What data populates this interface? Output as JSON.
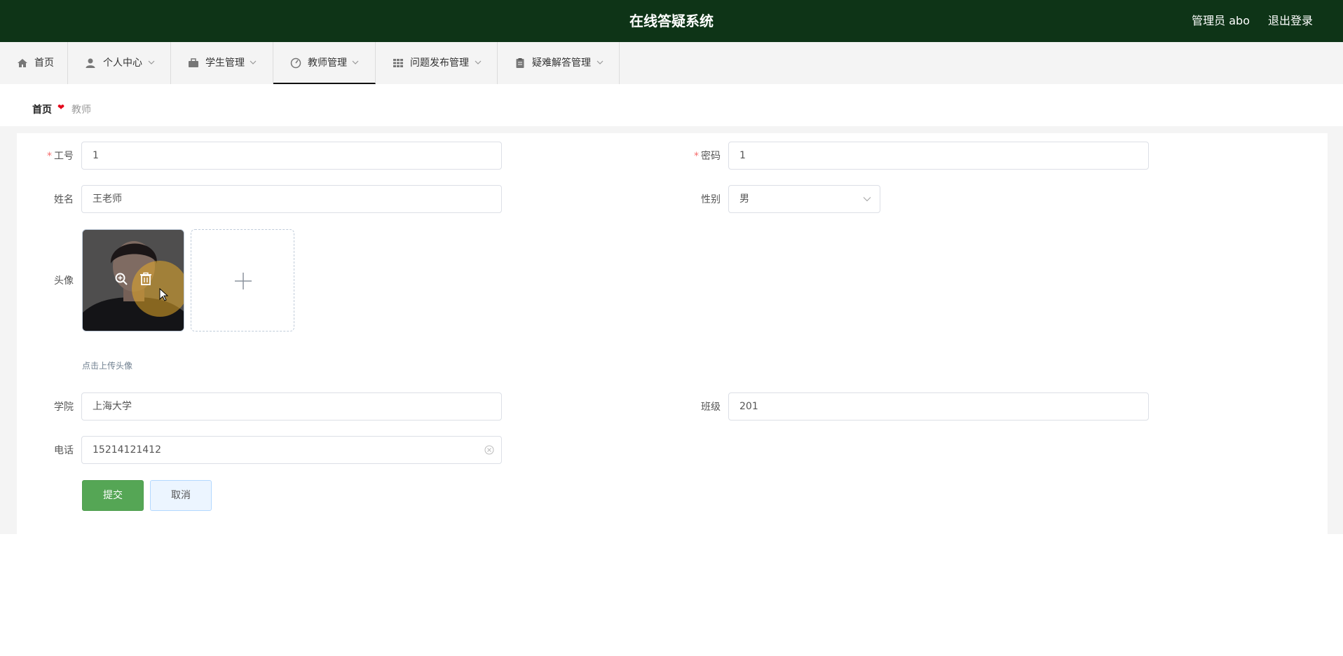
{
  "header": {
    "title": "在线答疑系统",
    "user": "管理员 abo",
    "logout": "退出登录"
  },
  "nav": {
    "items": [
      {
        "label": "首页",
        "icon": "home-icon"
      },
      {
        "label": "个人中心",
        "icon": "user-icon"
      },
      {
        "label": "学生管理",
        "icon": "briefcase-icon"
      },
      {
        "label": "教师管理",
        "icon": "gauge-icon"
      },
      {
        "label": "问题发布管理",
        "icon": "grid-icon"
      },
      {
        "label": "疑难解答管理",
        "icon": "clipboard-icon"
      }
    ],
    "active": "教师管理"
  },
  "breadcrumb": {
    "home": "首页",
    "current": "教师"
  },
  "form": {
    "id_label": "工号",
    "id_value": "1",
    "password_label": "密码",
    "password_value": "1",
    "name_label": "姓名",
    "name_value": "王老师",
    "gender_label": "性别",
    "gender_value": "男",
    "avatar_label": "头像",
    "avatar_hint": "点击上传头像",
    "college_label": "学院",
    "college_value": "上海大学",
    "class_label": "班级",
    "class_value": "201",
    "phone_label": "电话",
    "phone_value": "15214121412",
    "submit": "提交",
    "cancel": "取消"
  },
  "colors": {
    "header_bg": "#0e3417",
    "submit_bg": "#55a655",
    "required": "#f56c6c"
  }
}
